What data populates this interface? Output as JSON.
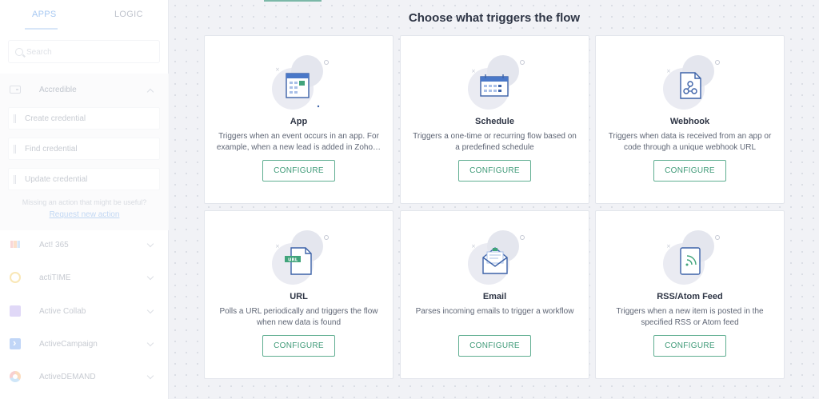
{
  "sidebar": {
    "tabs": {
      "apps": "APPS",
      "logic": "LOGIC"
    },
    "search": {
      "placeholder": "Search",
      "value": ""
    },
    "active_group": {
      "title": "Accredible",
      "actions": [
        "Create credential",
        "Find credential",
        "Update credential"
      ],
      "missing_text": "Missing an action that might be useful?",
      "request_link": "Request new action"
    },
    "apps": [
      {
        "label": "Act! 365",
        "icon": "act-365-icon"
      },
      {
        "label": "actiTIME",
        "icon": "actitime-icon"
      },
      {
        "label": "Active Collab",
        "icon": "active-collab-icon"
      },
      {
        "label": "ActiveCampaign",
        "icon": "activecampaign-icon"
      },
      {
        "label": "ActiveDEMAND",
        "icon": "activedemand-icon"
      }
    ]
  },
  "main": {
    "title": "Choose what triggers the flow",
    "cards": [
      {
        "title": "App",
        "description": "Triggers when an event occurs in an app. For example, when a new lead is added in Zoho…",
        "button": "CONFIGURE",
        "icon": "app-window-icon"
      },
      {
        "title": "Schedule",
        "description": "Triggers a one-time or recurring flow based on a predefined schedule",
        "button": "CONFIGURE",
        "icon": "calendar-icon"
      },
      {
        "title": "Webhook",
        "description": "Triggers when data is received from an app or code through a unique webhook URL",
        "button": "CONFIGURE",
        "icon": "webhook-icon"
      },
      {
        "title": "URL",
        "description": "Polls a URL periodically and triggers the flow when new data is found",
        "button": "CONFIGURE",
        "icon": "url-file-icon"
      },
      {
        "title": "Email",
        "description": "Parses incoming emails to trigger a workflow",
        "button": "CONFIGURE",
        "icon": "envelope-icon"
      },
      {
        "title": "RSS/Atom Feed",
        "description": "Triggers when a new item is posted in the specified RSS or Atom feed",
        "button": "CONFIGURE",
        "icon": "rss-feed-icon"
      }
    ]
  },
  "colors": {
    "accent_green": "#3f9a78",
    "accent_blue": "#4a78c8",
    "link_blue": "#8fb6ea"
  }
}
